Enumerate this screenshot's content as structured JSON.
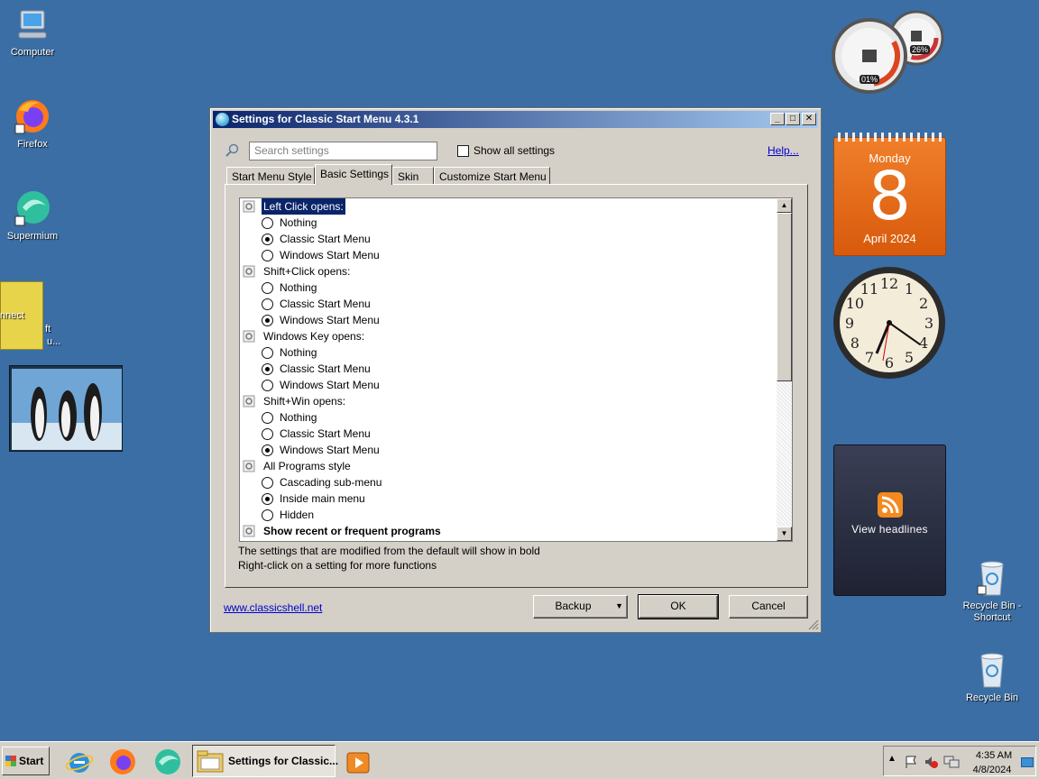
{
  "desktop": {
    "icons": [
      {
        "label": "Computer"
      },
      {
        "label": "Firefox"
      },
      {
        "label": "Supermium"
      },
      {
        "label": "nnect"
      },
      {
        "label": "ft"
      },
      {
        "label": "u..."
      },
      {
        "label": "Recycle Bin - Shortcut"
      },
      {
        "label": "Recycle Bin"
      }
    ]
  },
  "gadgets": {
    "cpu_meter": {
      "cpu": "01%",
      "ram": "26%"
    },
    "calendar": {
      "day_of_week": "Monday",
      "day": "8",
      "month_year": "April 2024"
    },
    "clock": {
      "numerals": [
        "12",
        "1",
        "2",
        "3",
        "4",
        "5",
        "6",
        "7",
        "8",
        "9",
        "10",
        "11"
      ]
    },
    "feed": {
      "label": "View headlines"
    }
  },
  "dialog": {
    "title": "Settings for Classic Start Menu 4.3.1",
    "search_placeholder": "Search settings",
    "show_all_label": "Show all settings",
    "help_label": "Help...",
    "tabs": [
      {
        "label": "Start Menu Style"
      },
      {
        "label": "Basic Settings"
      },
      {
        "label": "Skin"
      },
      {
        "label": "Customize Start Menu"
      }
    ],
    "active_tab": "Basic Settings",
    "groups": [
      {
        "label": "Left Click opens:",
        "options": [
          {
            "label": "Nothing",
            "selected": false
          },
          {
            "label": "Classic Start Menu",
            "selected": true
          },
          {
            "label": "Windows Start Menu",
            "selected": false
          }
        ]
      },
      {
        "label": "Shift+Click opens:",
        "options": [
          {
            "label": "Nothing",
            "selected": false
          },
          {
            "label": "Classic Start Menu",
            "selected": false
          },
          {
            "label": "Windows Start Menu",
            "selected": true
          }
        ]
      },
      {
        "label": "Windows Key opens:",
        "options": [
          {
            "label": "Nothing",
            "selected": false
          },
          {
            "label": "Classic Start Menu",
            "selected": true
          },
          {
            "label": "Windows Start Menu",
            "selected": false
          }
        ]
      },
      {
        "label": "Shift+Win opens:",
        "options": [
          {
            "label": "Nothing",
            "selected": false
          },
          {
            "label": "Classic Start Menu",
            "selected": false
          },
          {
            "label": "Windows Start Menu",
            "selected": true
          }
        ]
      },
      {
        "label": "All Programs style",
        "options": [
          {
            "label": "Cascading sub-menu",
            "selected": false
          },
          {
            "label": "Inside main menu",
            "selected": true
          },
          {
            "label": "Hidden",
            "selected": false
          }
        ]
      },
      {
        "label": "Show recent or frequent programs",
        "options": []
      }
    ],
    "note_line1": "The settings that are modified from the default will show in bold",
    "note_line2": "Right-click on a setting for more functions",
    "website": "www.classicshell.net",
    "backup_label": "Backup",
    "ok_label": "OK",
    "cancel_label": "Cancel"
  },
  "taskbar": {
    "start_label": "Start",
    "active_task": "Settings for Classic...",
    "time": "4:35 AM",
    "date": "4/8/2024"
  }
}
